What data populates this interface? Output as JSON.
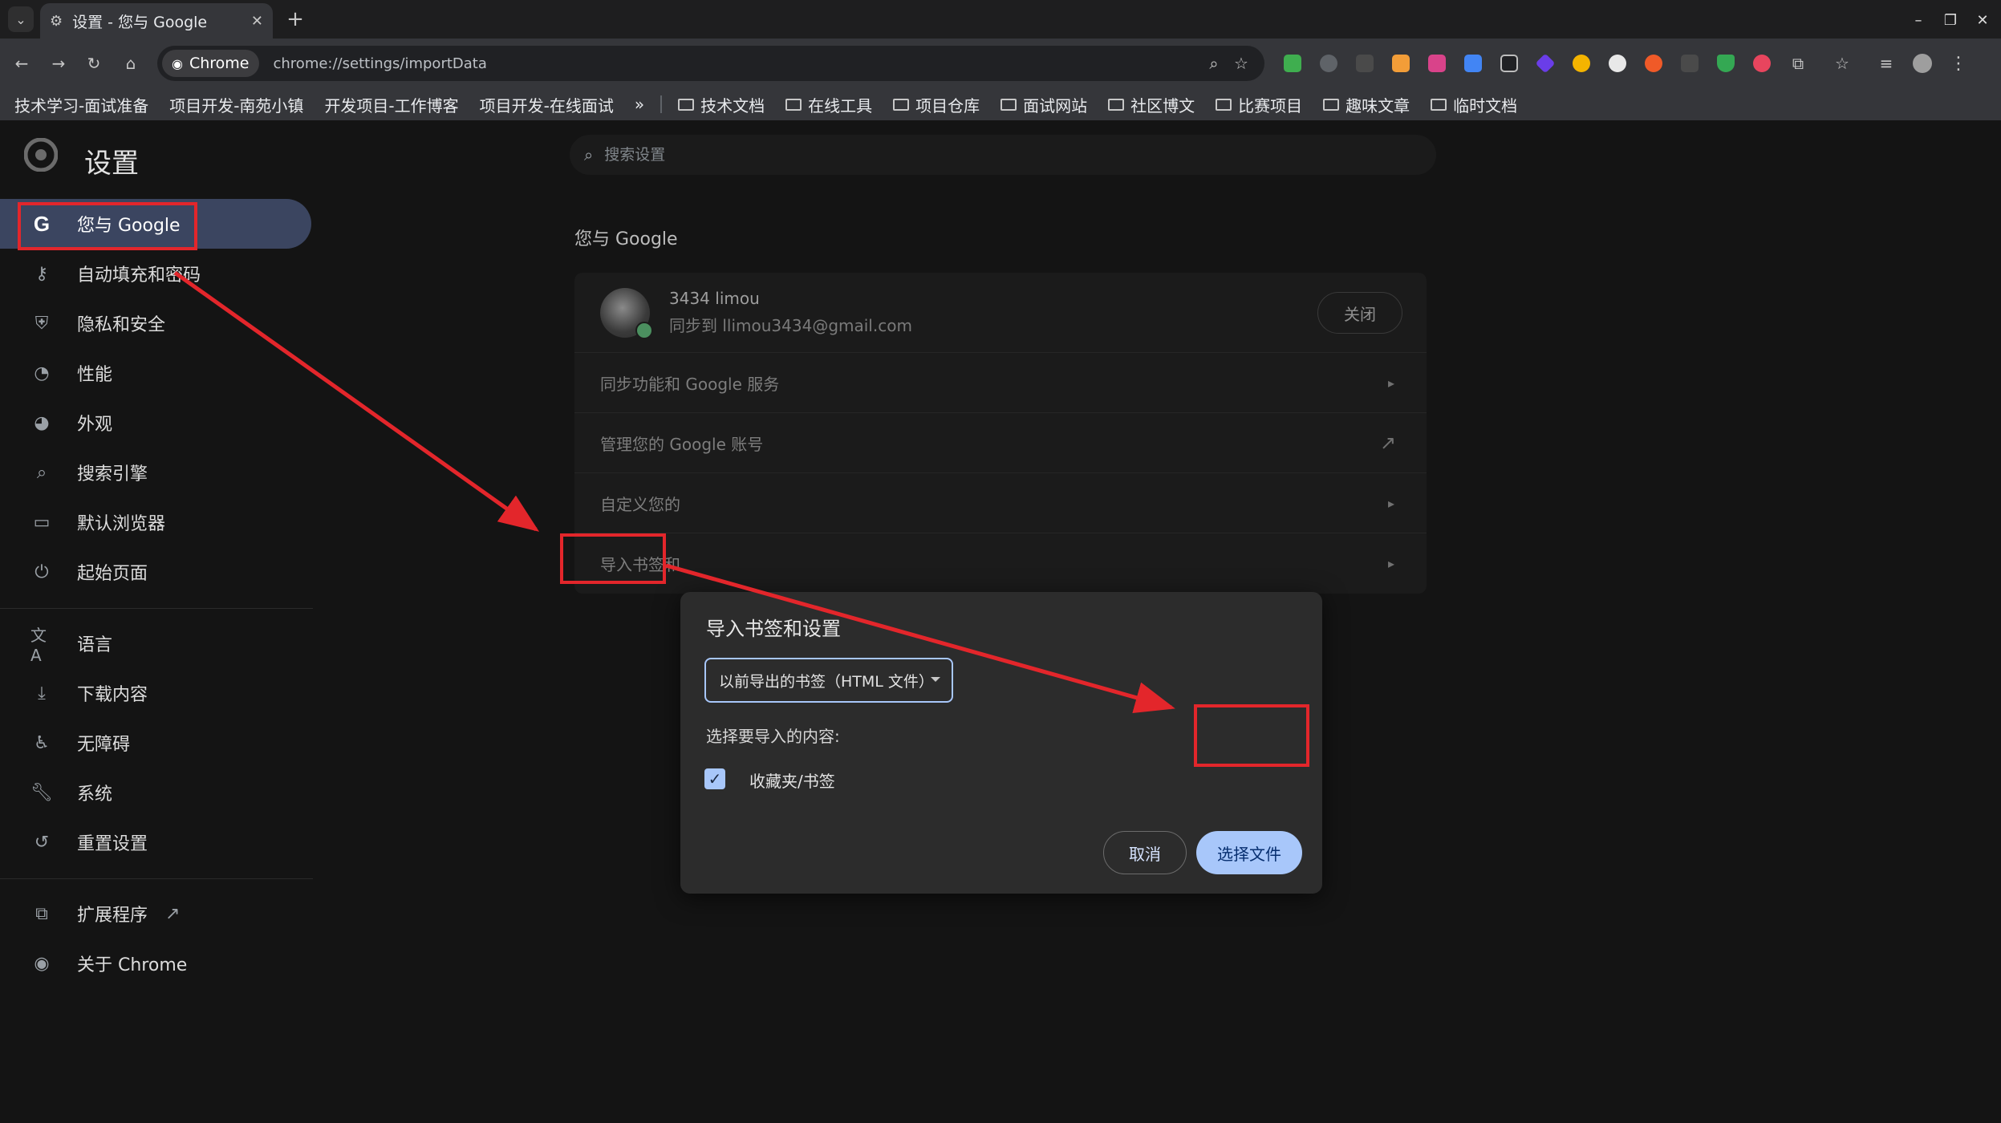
{
  "tab": {
    "title": "设置 - 您与 Google",
    "close": "✕"
  },
  "window": {
    "minimize": "–",
    "restore": "❐",
    "close": "✕"
  },
  "toolbar": {
    "chip_label": "Chrome",
    "url": "chrome://settings/importData"
  },
  "bookmarks": {
    "items": [
      "技术学习-面试准备",
      "项目开发-南苑小镇",
      "开发项目-工作博客",
      "项目开发-在线面试"
    ],
    "overflow": "»",
    "folders": [
      "技术文档",
      "在线工具",
      "项目仓库",
      "面试网站",
      "社区博文",
      "比赛项目",
      "趣味文章",
      "临时文档"
    ]
  },
  "settings": {
    "title": "设置",
    "search_placeholder": "搜索设置",
    "nav": [
      {
        "label": "您与 Google",
        "icon": "google-icon"
      },
      {
        "label": "自动填充和密码",
        "icon": "key-icon"
      },
      {
        "label": "隐私和安全",
        "icon": "shield-icon"
      },
      {
        "label": "性能",
        "icon": "speedometer-icon"
      },
      {
        "label": "外观",
        "icon": "palette-icon"
      },
      {
        "label": "搜索引擎",
        "icon": "search-icon"
      },
      {
        "label": "默认浏览器",
        "icon": "browser-icon"
      },
      {
        "label": "起始页面",
        "icon": "power-icon"
      },
      {
        "label": "语言",
        "icon": "translate-icon"
      },
      {
        "label": "下载内容",
        "icon": "download-icon"
      },
      {
        "label": "无障碍",
        "icon": "accessibility-icon"
      },
      {
        "label": "系统",
        "icon": "wrench-icon"
      },
      {
        "label": "重置设置",
        "icon": "reset-icon"
      },
      {
        "label": "扩展程序",
        "icon": "extension-icon"
      },
      {
        "label": "关于 Chrome",
        "icon": "chrome-icon"
      }
    ],
    "section_title": "您与 Google",
    "profile": {
      "name": "3434 limou",
      "sync": "同步到 llimou3434@gmail.com",
      "turn_off": "关闭"
    },
    "rows": [
      "同步功能和 Google 服务",
      "管理您的 Google 账号",
      "自定义您的",
      "导入书签和"
    ]
  },
  "dialog": {
    "title": "导入书签和设置",
    "selected_source": "以前导出的书签（HTML 文件）",
    "choose_label": "选择要导入的内容:",
    "checkbox_label": "收藏夹/书签",
    "checkbox_checked": true,
    "cancel": "取消",
    "choose_file": "选择文件"
  },
  "annotation_color": "#e3262b"
}
